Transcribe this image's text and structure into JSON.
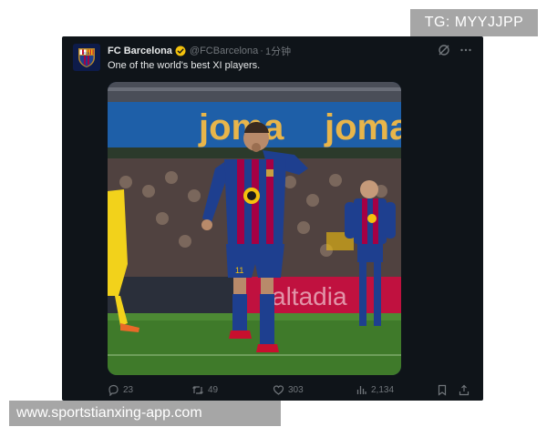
{
  "watermark_top": "TG: MYYJJPP",
  "watermark_bottom": "www.sportstianxing-app.com",
  "tweet": {
    "display_name": "FC Barcelona",
    "handle": "@FCBarcelona",
    "separator": "·",
    "time": "1分钟",
    "text": "One of the world's best XI players.",
    "media": {
      "banner_text": "joma",
      "ad_board_text": "altadia",
      "crest_text": "FCB",
      "jersey_number": "11"
    },
    "stats": {
      "replies": "23",
      "retweets": "49",
      "likes": "303",
      "views": "2,134"
    }
  },
  "colors": {
    "card_bg": "#0f1419",
    "text_primary": "#e7e9ea",
    "text_secondary": "#71767b",
    "verified_badge": "#f4c20d",
    "barca_blue": "#1e3f8f",
    "barca_red": "#a50044",
    "pitch_green": "#3f7a2a"
  }
}
